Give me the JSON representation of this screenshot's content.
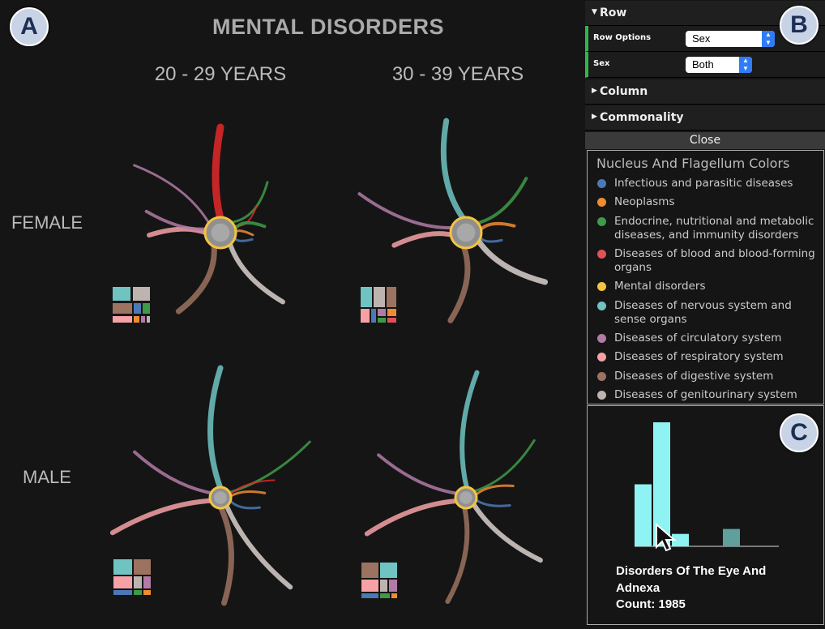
{
  "title": "MENTAL DISORDERS",
  "panel_labels": [
    "A",
    "B",
    "C"
  ],
  "columns": [
    "20 - 29 YEARS",
    "30 - 39 YEARS"
  ],
  "rows": [
    "FEMALE",
    "MALE"
  ],
  "row_panel": {
    "row": {
      "label": "Row",
      "expanded": true
    },
    "row_options": {
      "label": "Row Options",
      "value": "Sex"
    },
    "sex": {
      "label": "Sex",
      "value": "Both"
    },
    "column": {
      "label": "Column"
    },
    "commonality": {
      "label": "Commonality"
    },
    "close": "Close"
  },
  "legend": {
    "title": "Nucleus And Flagellum Colors",
    "items": [
      {
        "label": "Infectious and parasitic diseases",
        "color": "#4a79b5"
      },
      {
        "label": "Neoplasms",
        "color": "#f08b33"
      },
      {
        "label": "Endocrine, nutritional and metabolic diseases, and immunity disorders",
        "color": "#3e9a46"
      },
      {
        "label": "Diseases of blood and blood-forming organs",
        "color": "#e05256"
      },
      {
        "label": "Mental disorders",
        "color": "#f2c442"
      },
      {
        "label": "Diseases of nervous system and sense organs",
        "color": "#6fc4c2"
      },
      {
        "label": "Diseases of circulatory system",
        "color": "#b27aa6"
      },
      {
        "label": "Diseases of respiratory system",
        "color": "#f5a1a6"
      },
      {
        "label": "Diseases of digestive system",
        "color": "#9c7260"
      },
      {
        "label": "Diseases of genitourinary system",
        "color": "#bdb4b0"
      }
    ]
  },
  "histogram": {
    "bars": [
      {
        "value": 0.5,
        "color": "#8ff3f3"
      },
      {
        "value": 1.0,
        "color": "#8ff3f3"
      },
      {
        "value": 0.1,
        "color": "#8ff3f3"
      },
      {
        "value": 0.0,
        "color": "#8ff3f3"
      },
      {
        "value": 0.14,
        "color": "#5fa09c"
      }
    ],
    "tooltip": {
      "name": "Disorders Of The Eye And Adnexa",
      "count": "Count: 1985"
    }
  }
}
